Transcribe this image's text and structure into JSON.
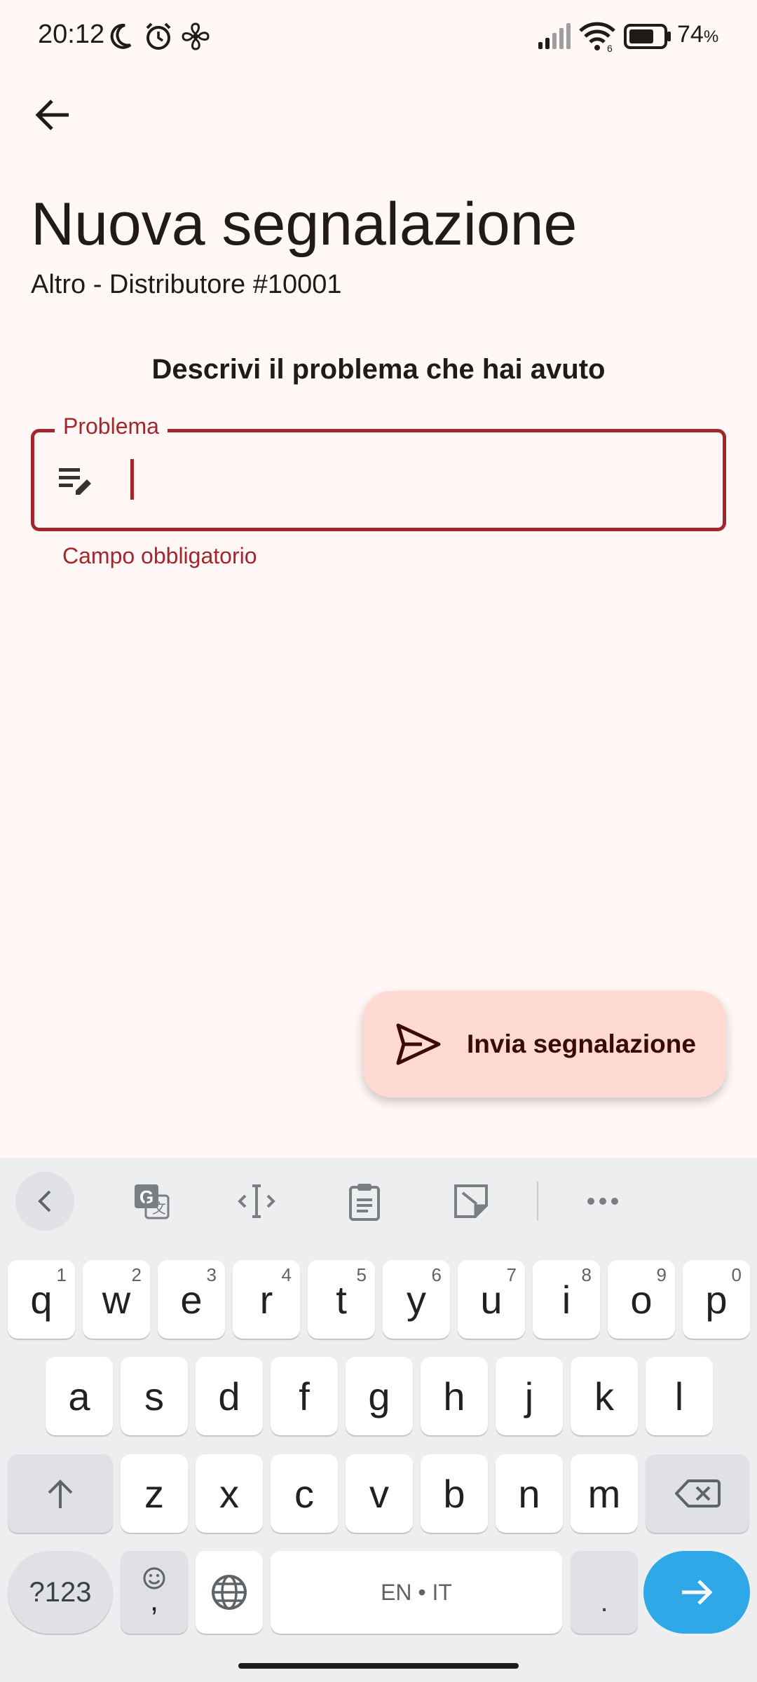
{
  "status_bar": {
    "time": "20:12",
    "battery_percent": "74",
    "battery_symbol": "%",
    "icons": [
      "moon-icon",
      "alarm-icon",
      "fan-icon",
      "signal-icon",
      "wifi-icon",
      "battery-icon"
    ]
  },
  "header": {
    "title": "Nuova segnalazione",
    "subtitle": "Altro - Distributore #10001"
  },
  "form": {
    "prompt": "Descrivi il problema che hai avuto",
    "field_label": "Problema",
    "field_value": "",
    "helper_text": "Campo obbligatorio",
    "error_color": "#a4262c"
  },
  "fab": {
    "label": "Invia segnalazione",
    "background": "#ffdad3"
  },
  "keyboard": {
    "toolbar": [
      "collapse-icon",
      "translate-icon",
      "text-cursor-icon",
      "clipboard-icon",
      "sticker-icon",
      "more-icon"
    ],
    "row1": [
      {
        "k": "q",
        "h": "1"
      },
      {
        "k": "w",
        "h": "2"
      },
      {
        "k": "e",
        "h": "3"
      },
      {
        "k": "r",
        "h": "4"
      },
      {
        "k": "t",
        "h": "5"
      },
      {
        "k": "y",
        "h": "6"
      },
      {
        "k": "u",
        "h": "7"
      },
      {
        "k": "i",
        "h": "8"
      },
      {
        "k": "o",
        "h": "9"
      },
      {
        "k": "p",
        "h": "0"
      }
    ],
    "row2": [
      "a",
      "s",
      "d",
      "f",
      "g",
      "h",
      "j",
      "k",
      "l"
    ],
    "row3": [
      "z",
      "x",
      "c",
      "v",
      "b",
      "n",
      "m"
    ],
    "symbols_label": "?123",
    "emoji_comma_label": ",",
    "space_label": "EN • IT",
    "period_label": ".",
    "enter_color": "#2ea8e6"
  }
}
